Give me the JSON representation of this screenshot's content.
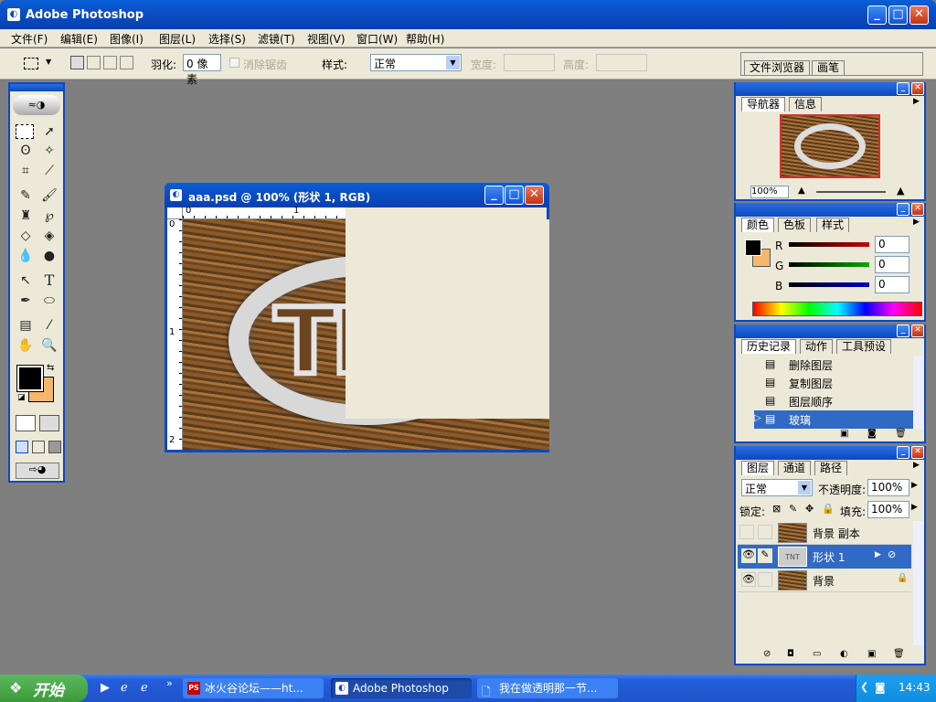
{
  "app": {
    "title": "Adobe Photoshop",
    "menu": [
      "文件(F)",
      "编辑(E)",
      "图像(I)",
      "图层(L)",
      "选择(S)",
      "滤镜(T)",
      "视图(V)",
      "窗口(W)",
      "帮助(H)"
    ]
  },
  "options": {
    "feather_label": "羽化:",
    "feather_value": "0 像素",
    "antialias_label": "消除锯齿",
    "style_label": "样式:",
    "style_value": "正常",
    "width_label": "宽度:",
    "height_label": "高度:",
    "tabs": [
      "文件浏览器",
      "画笔"
    ]
  },
  "document": {
    "title": "aaa.psd @ 100% (形状 1, RGB)",
    "ruler_h": [
      "0",
      "1"
    ],
    "ruler_v": [
      "0",
      "1",
      "2"
    ],
    "logo_text": "TNT"
  },
  "navigator": {
    "tabs": [
      "导航器",
      "信息"
    ],
    "zoom": "100%"
  },
  "color": {
    "tabs": [
      "颜色",
      "色板",
      "样式"
    ],
    "channels": [
      {
        "label": "R",
        "value": "0",
        "color": "#cc0000"
      },
      {
        "label": "G",
        "value": "0",
        "color": "#00aa00"
      },
      {
        "label": "B",
        "value": "0",
        "color": "#0000cc"
      }
    ],
    "foreground": "#000000",
    "background": "#f4b76d"
  },
  "history": {
    "tabs": [
      "历史记录",
      "动作",
      "工具预设"
    ],
    "items": [
      "删除图层",
      "复制图层",
      "图层顺序",
      "玻璃"
    ],
    "selected_index": 3
  },
  "layers": {
    "tabs": [
      "图层",
      "通道",
      "路径"
    ],
    "blend_mode": "正常",
    "opacity_label": "不透明度:",
    "opacity": "100%",
    "lock_label": "锁定:",
    "fill_label": "填充:",
    "fill": "100%",
    "items": [
      {
        "name": "背景 副本",
        "visible": false,
        "selected": false
      },
      {
        "name": "形状 1",
        "visible": true,
        "selected": true
      },
      {
        "name": "背景",
        "visible": true,
        "selected": false
      }
    ]
  },
  "taskbar": {
    "start": "开始",
    "tasks": [
      "冰火谷论坛——ht...",
      "Adobe Photoshop",
      "我在做透明那一节..."
    ],
    "clock": "14:43"
  },
  "colors": {
    "xp_blue": "#0b49c0",
    "selection": "#316ac5",
    "taskbar": "#245edb",
    "start_green": "#3c9a3c"
  }
}
